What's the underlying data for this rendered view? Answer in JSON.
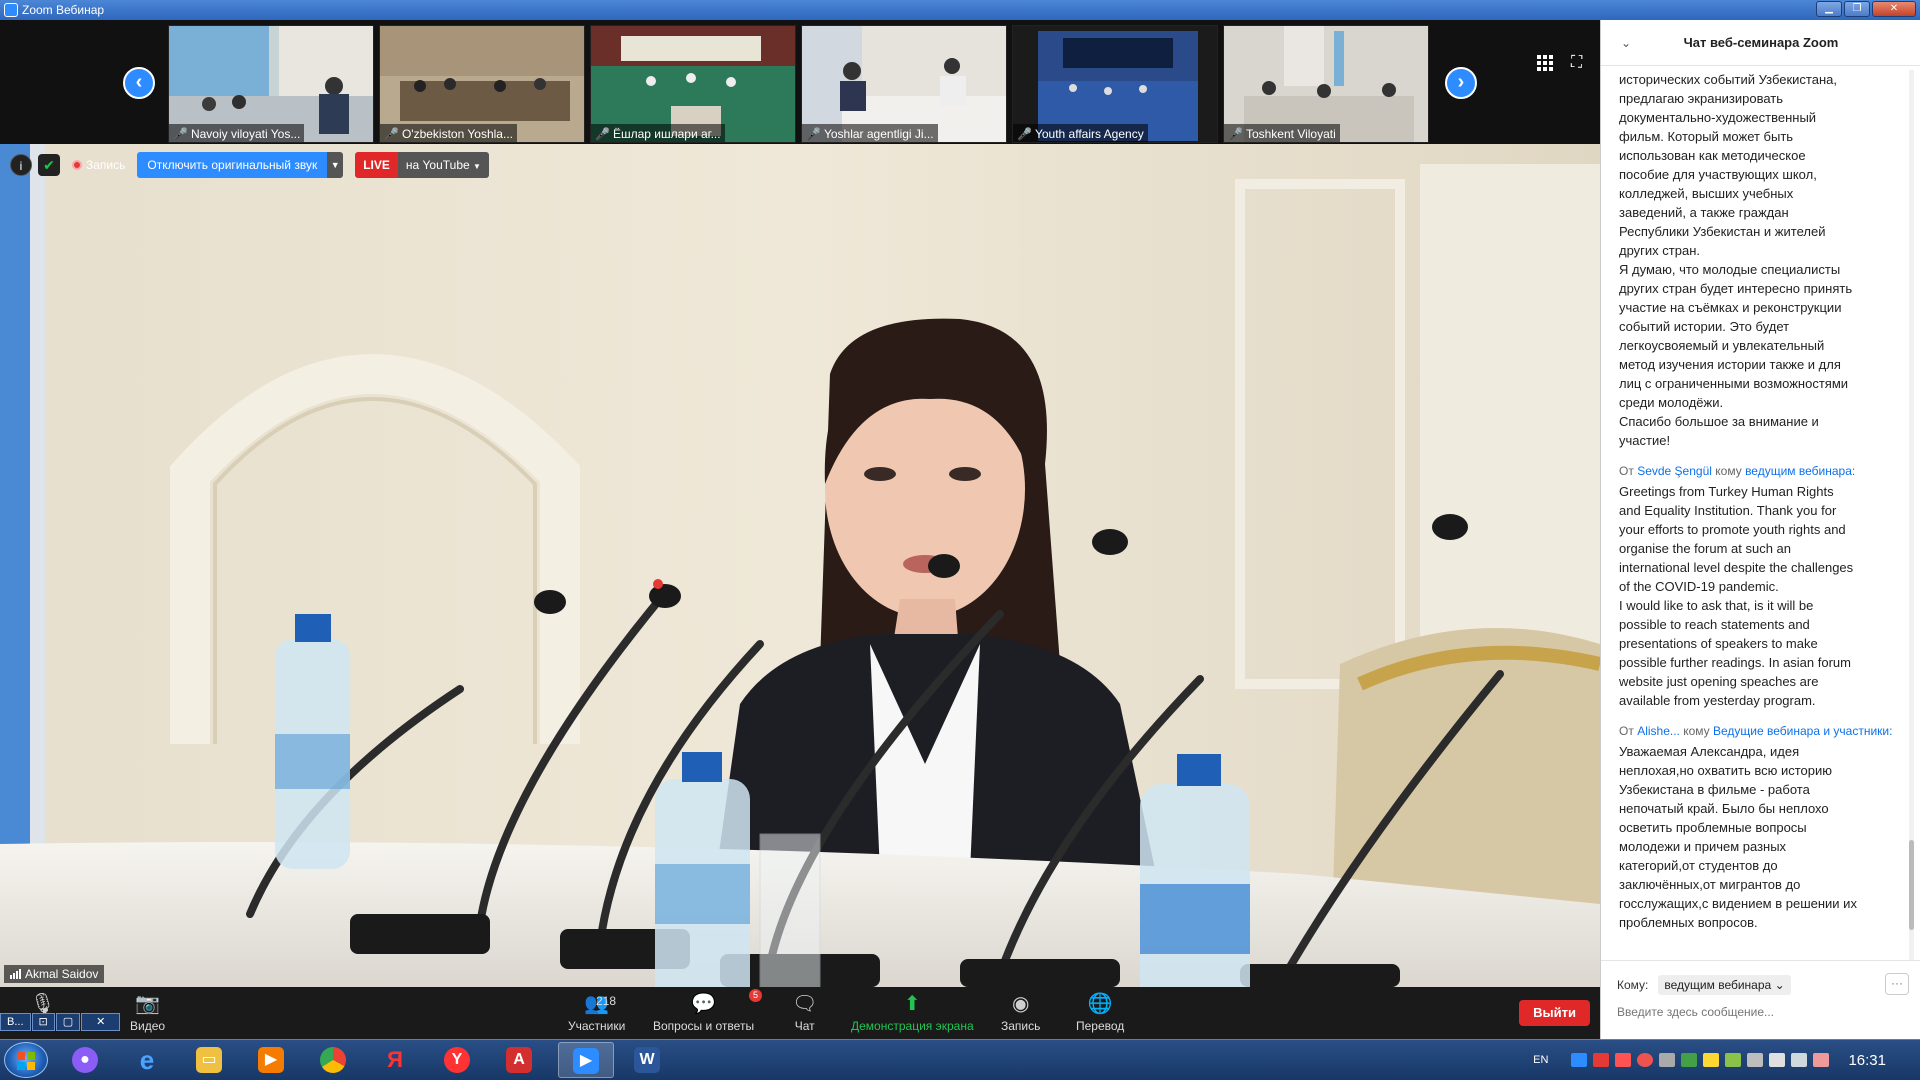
{
  "window": {
    "title": "Zoom Вебинар"
  },
  "thumbnails": [
    {
      "name": "Navoiy viloyati Yos..."
    },
    {
      "name": "O'zbekiston Yoshla..."
    },
    {
      "name": "Ёшлар ишлари аг..."
    },
    {
      "name": "Yoshlar agentligi Ji..."
    },
    {
      "name": "Youth affairs Agency"
    },
    {
      "name": "Toshkent Viloyati"
    }
  ],
  "main_video": {
    "record_label": "Запись",
    "original_sound_button": "Отключить оригинальный звук",
    "live_label": "LIVE",
    "stream_target": "на YouTube",
    "speaker_name": "Akmal Saidov"
  },
  "toolbar": {
    "video_label": "Видео",
    "participants_label": "Участники",
    "participants_count": "218",
    "qa_label": "Вопросы и ответы",
    "qa_badge": "5",
    "chat_label": "Чат",
    "share_label": "Демонстрация экрана",
    "record_label": "Запись",
    "translate_label": "Перевод",
    "leave_label": "Выйти"
  },
  "chat": {
    "title": "Чат веб-семинара Zoom",
    "messages": [
      {
        "from": "",
        "to": "",
        "to_word": "",
        "text": "исторических событий Узбекистана,\nпредлагаю экранизировать\nдокументально-художественный\nфильм. Который может быть\nиспользован как методическое\nпособие для участвующих школ,\nколледжей, высших учебных\nзаведений, а также граждан\nРеспублики Узбекистан и жителей\nдругих стран.\nЯ думаю, что молодые специалисты\nдругих стран будет интересно принять\nучастие на съёмках и реконструкции\nсобытий истории. Это будет\nлегкоусвояемый и увлекательный\nметод изучения истории также и для\nлиц с ограниченными возможностями\nсреди молодёжи.\nСпасибо большое за внимание и\nучастие!"
      },
      {
        "from_word": "От",
        "from": "Sevde Şengül",
        "to_word": "кому",
        "to": "ведущим вебинара:",
        "text": "Greetings from Turkey Human Rights\nand Equality Institution. Thank you for\nyour efforts to promote youth rights and\norganise the forum at such an\ninternational level despite the challenges\nof the COVID-19 pandemic.\nI would like to ask that, is it will be\npossible to reach statements and\npresentations of speakers to make\npossible further readings. In asian forum\nwebsite just opening speaches are\navailable from yesterday program."
      },
      {
        "from_word": "От",
        "from": "Alishe...",
        "to_word": "кому",
        "to": "Ведущие вебинара и участники:",
        "text": "Уважаемая Александра, идея\nнеплохая,но охватить всю историю\nУзбекистана в фильме - работа\nнепочатый край. Было бы неплохо\nосветить проблемные вопросы\nмолодежи и причем разных\nкатегорий,от студентов до\nзаключённых,от мигрантов до\nгосслужащих,с видением в решении их\nпроблемных вопросов."
      }
    ],
    "to_label": "Кому:",
    "to_value": "ведущим вебинара",
    "input_placeholder": "Введите здесь сообщение..."
  },
  "taskbar": {
    "lang": "EN",
    "clock": "16:31",
    "taskbar_app_label": "B..."
  }
}
